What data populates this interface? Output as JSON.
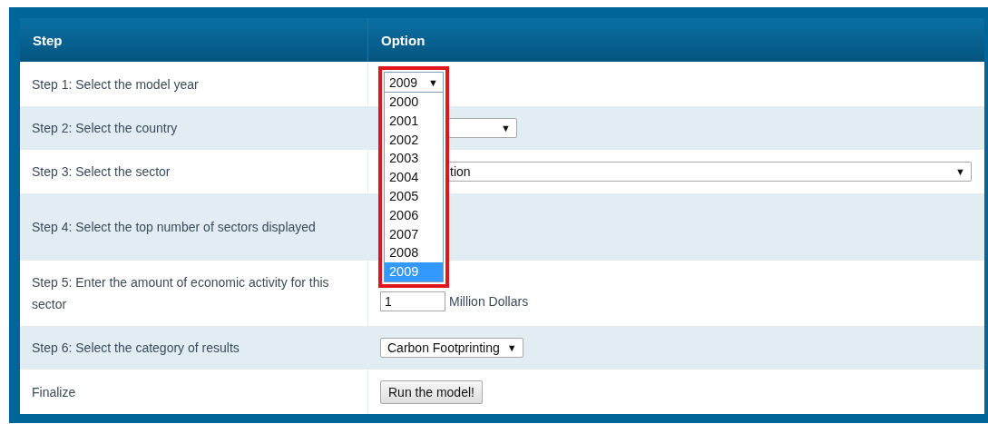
{
  "table": {
    "columns": [
      "Step",
      "Option"
    ],
    "rows": [
      {
        "step": "Step 1: Select the model year",
        "kind": "year",
        "control": {
          "value": "2009",
          "arrow": "▼",
          "options": [
            {
              "label": "2000",
              "selected": false
            },
            {
              "label": "2001",
              "selected": false
            },
            {
              "label": "2002",
              "selected": false
            },
            {
              "label": "2003",
              "selected": false
            },
            {
              "label": "2004",
              "selected": false
            },
            {
              "label": "2005",
              "selected": false
            },
            {
              "label": "2006",
              "selected": false
            },
            {
              "label": "2007",
              "selected": false
            },
            {
              "label": "2008",
              "selected": false
            },
            {
              "label": "2009",
              "selected": true
            }
          ]
        }
      },
      {
        "step": "Step 2: Select the country",
        "kind": "select",
        "control": {
          "arrow": "▼"
        }
      },
      {
        "step": "Step 3: Select the sector",
        "kind": "select",
        "control": {
          "value": "tion",
          "arrow": "▼"
        }
      },
      {
        "step": "Step 4: Select the top number of sectors displayed",
        "kind": "blank"
      },
      {
        "step": "Step 5: Enter the amount of economic activity for this sector",
        "kind": "amount",
        "control": {
          "value": "1",
          "unit": "Million Dollars"
        }
      },
      {
        "step": "Step 6: Select the category of results",
        "kind": "select",
        "control": {
          "value": "Carbon Footprinting",
          "arrow": "▼"
        }
      },
      {
        "step": "Finalize",
        "kind": "button",
        "control": {
          "label": "Run the model!"
        }
      }
    ]
  }
}
